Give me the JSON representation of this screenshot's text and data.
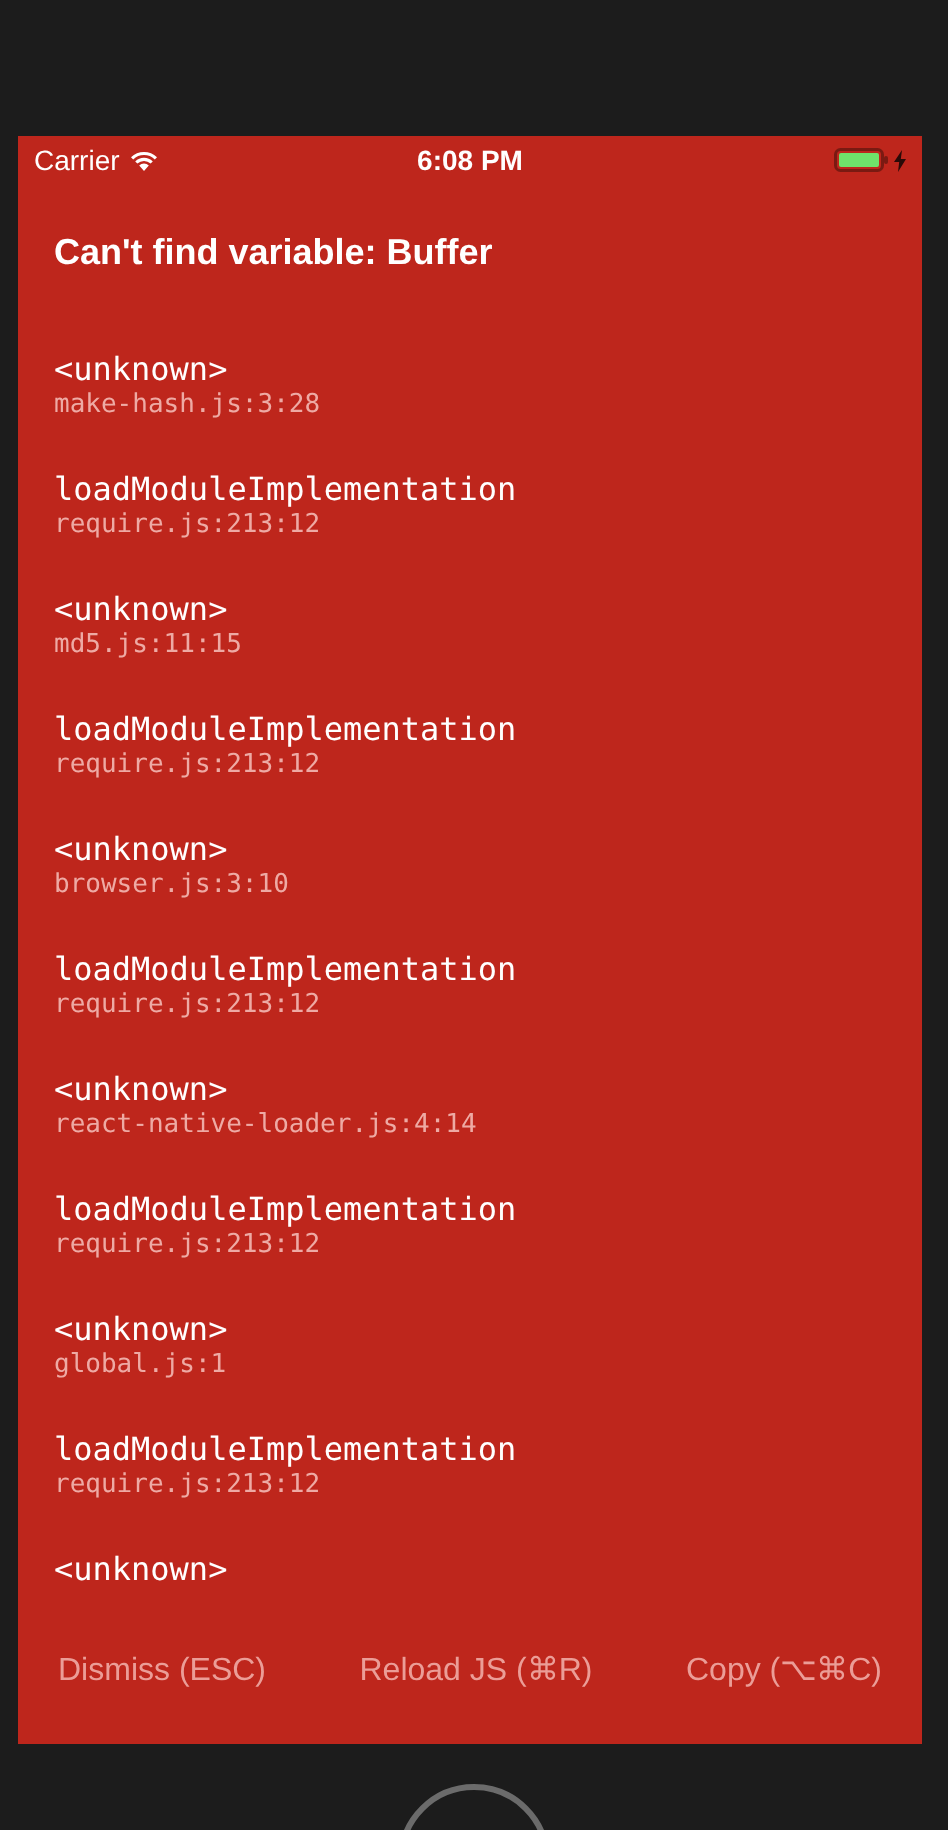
{
  "status_bar": {
    "carrier": "Carrier",
    "time": "6:08 PM"
  },
  "error": {
    "message": "Can't find variable: Buffer"
  },
  "stack": [
    {
      "method": "<unknown>",
      "file": "make-hash.js:3:28"
    },
    {
      "method": "loadModuleImplementation",
      "file": "require.js:213:12"
    },
    {
      "method": "<unknown>",
      "file": "md5.js:11:15"
    },
    {
      "method": "loadModuleImplementation",
      "file": "require.js:213:12"
    },
    {
      "method": "<unknown>",
      "file": "browser.js:3:10"
    },
    {
      "method": "loadModuleImplementation",
      "file": "require.js:213:12"
    },
    {
      "method": "<unknown>",
      "file": "react-native-loader.js:4:14"
    },
    {
      "method": "loadModuleImplementation",
      "file": "require.js:213:12"
    },
    {
      "method": "<unknown>",
      "file": "global.js:1"
    },
    {
      "method": "loadModuleImplementation",
      "file": "require.js:213:12"
    },
    {
      "method": "<unknown>"
    }
  ],
  "buttons": [
    "Dismiss (ESC)",
    "Reload JS (⌘R)",
    "Copy (⌥⌘C)"
  ]
}
